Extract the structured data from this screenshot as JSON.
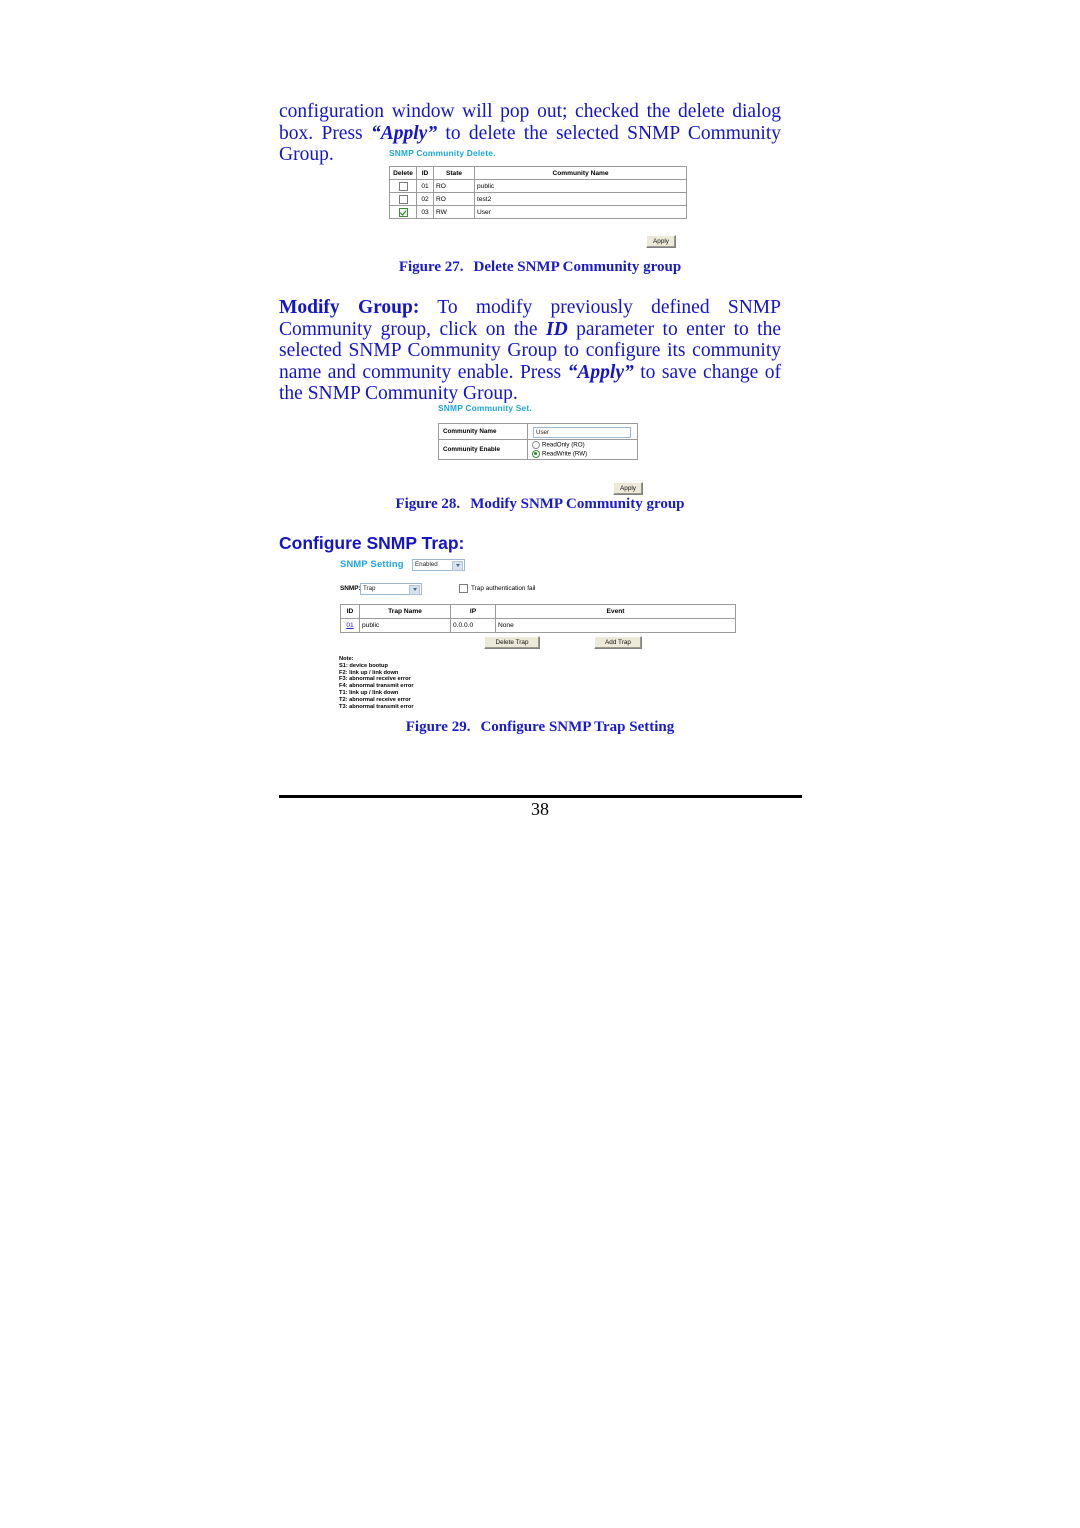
{
  "document": {
    "page_number": "38"
  },
  "paragraphs": {
    "intro": {
      "line1": "configuration window will pop out; checked the delete dialog box.",
      "line2_pre": "Press ",
      "line2_emph": "“Apply”",
      "line2_post": " to delete the selected SNMP Community Group."
    },
    "modify": {
      "lead": "Modify Group:",
      "text_a": " To modify previously defined SNMP Community group, click on the ",
      "emph_id": "ID",
      "text_b": " parameter to enter to the selected SNMP Community Group to configure its community name and community enable. Press ",
      "emph_apply": "“Apply”",
      "text_c": " to save change of the SNMP Community Group."
    }
  },
  "headings": {
    "configure_snmp_trap": "Configure SNMP Trap:"
  },
  "captions": {
    "fig27": {
      "number": "Figure 27.",
      "title": "Delete SNMP Community group"
    },
    "fig28": {
      "number": "Figure 28.",
      "title": "Modify SNMP Community group"
    },
    "fig29": {
      "number": "Figure 29.",
      "title": "Configure SNMP Trap Setting"
    }
  },
  "figure27": {
    "title": "SNMP Community Delete.",
    "columns": [
      "Delete",
      "ID",
      "State",
      "Community Name"
    ],
    "rows": [
      {
        "checked": false,
        "id": "01",
        "state": "RO",
        "name": "public"
      },
      {
        "checked": false,
        "id": "02",
        "state": "RO",
        "name": "test2"
      },
      {
        "checked": true,
        "id": "03",
        "state": "RW",
        "name": "User"
      }
    ],
    "apply_label": "Apply"
  },
  "figure28": {
    "title": "SNMP Community Set.",
    "label_community_name": "Community Name",
    "community_name_value": "User",
    "label_community_enable": "Community Enable",
    "option_readonly": "ReadOnly (RO)",
    "option_readwrite": "ReadWrite (RW)",
    "selected_option": "ReadWrite (RW)",
    "apply_label": "Apply"
  },
  "figure29": {
    "title": "SNMP Setting",
    "state_select_value": "Enabled",
    "snmp_label": "SNMP:",
    "snmp_select_value": "Trap",
    "trap_auth_label": "Trap authentication fail",
    "trap_auth_checked": false,
    "columns": [
      "ID",
      "Trap Name",
      "IP",
      "Event"
    ],
    "rows": [
      {
        "id": "01",
        "trap_name": "public",
        "ip": "0.0.0.0",
        "event": "None"
      }
    ],
    "delete_trap_label": "Delete Trap",
    "add_trap_label": "Add Trap",
    "notes_title": "Note:",
    "notes": [
      "S1: device bootup",
      "F2: link up / link down",
      "F3: abnormal receive error",
      "F4: abnormal transmit error",
      "T1: link up / link down",
      "T2: abnormal receive error",
      "T3: abnormal transmit error"
    ]
  },
  "colors": {
    "body_text": "#1414c8",
    "caption": "#1a1acd",
    "shot_title": "#1ea6e0",
    "link": "#2222cc"
  }
}
